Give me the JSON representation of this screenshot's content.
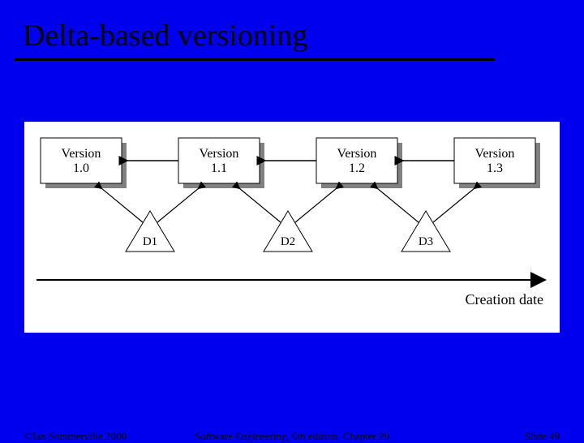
{
  "title": "Delta-based versioning",
  "versions": [
    "Version\n1.0",
    "Version\n1.1",
    "Version\n1.2",
    "Version\n1.3"
  ],
  "deltas": [
    "D1",
    "D2",
    "D3"
  ],
  "axis_label": "Creation date",
  "footer": {
    "left": "©Ian Sommerville 2000",
    "center": "Software Engineering, 6th edition. Chapter 29",
    "right": "Slide 49"
  },
  "chart_data": {
    "type": "diagram",
    "title": "Delta-based versioning",
    "nodes": [
      {
        "id": "v1.0",
        "label": "Version 1.0",
        "kind": "version"
      },
      {
        "id": "v1.1",
        "label": "Version 1.1",
        "kind": "version"
      },
      {
        "id": "v1.2",
        "label": "Version 1.2",
        "kind": "version"
      },
      {
        "id": "v1.3",
        "label": "Version 1.3",
        "kind": "version"
      },
      {
        "id": "d1",
        "label": "D1",
        "kind": "delta"
      },
      {
        "id": "d2",
        "label": "D2",
        "kind": "delta"
      },
      {
        "id": "d3",
        "label": "D3",
        "kind": "delta"
      }
    ],
    "edges": [
      {
        "from": "v1.1",
        "to": "v1.0",
        "kind": "prev-version"
      },
      {
        "from": "v1.2",
        "to": "v1.1",
        "kind": "prev-version"
      },
      {
        "from": "v1.3",
        "to": "v1.2",
        "kind": "prev-version"
      },
      {
        "from": "d1",
        "to": "v1.0",
        "kind": "delta-between",
        "also_to": "v1.1"
      },
      {
        "from": "d2",
        "to": "v1.1",
        "kind": "delta-between",
        "also_to": "v1.2"
      },
      {
        "from": "d3",
        "to": "v1.2",
        "kind": "delta-between",
        "also_to": "v1.3"
      }
    ],
    "axis": "Creation date"
  }
}
